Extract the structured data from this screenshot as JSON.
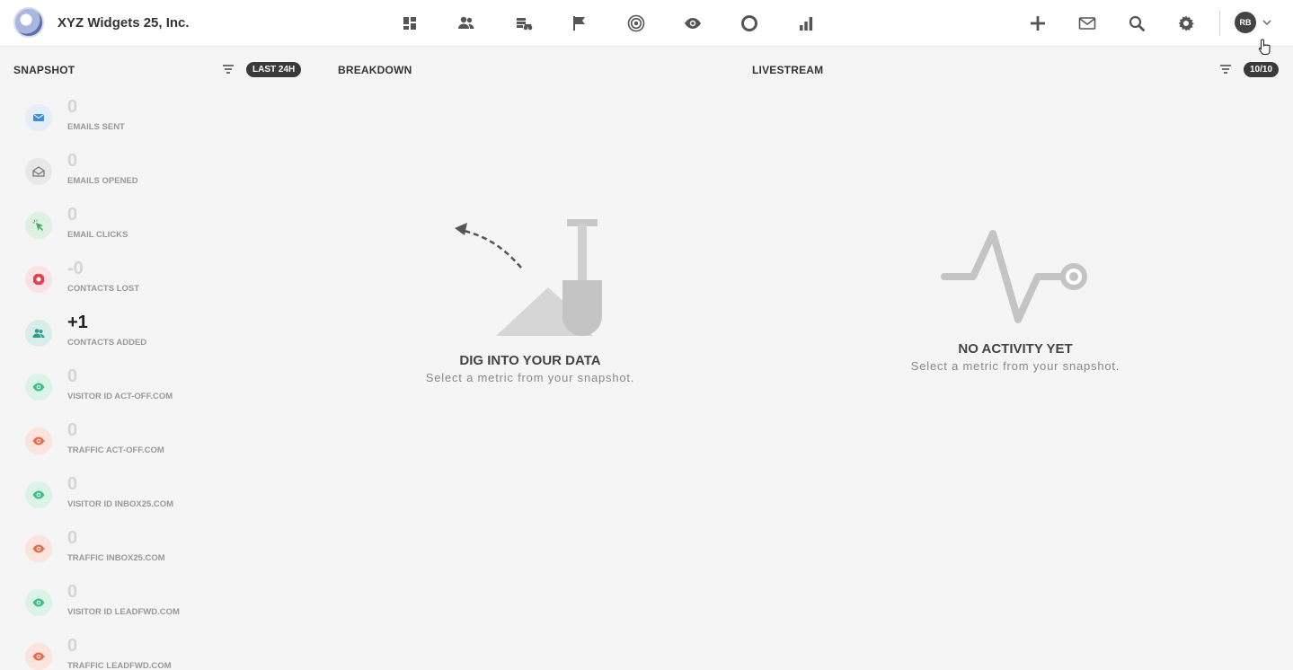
{
  "header": {
    "company": "XYZ Widgets 25, Inc.",
    "nav_icons": [
      "dashboard-icon",
      "contacts-icon",
      "companies-icon",
      "campaigns-flag-icon",
      "target-icon",
      "visitor-eye-icon",
      "circle-icon",
      "reports-bar-icon"
    ],
    "actions": [
      "plus-icon",
      "mail-icon",
      "search-icon",
      "gear-icon"
    ],
    "user_initials": "RB"
  },
  "snapshot": {
    "title": "SNAPSHOT",
    "range_pill": "LAST 24H",
    "metrics": [
      {
        "value": "0",
        "label": "EMAILS SENT",
        "icon": "email-sent-icon",
        "color": "#3d8fd9",
        "bg": "#e4eef8"
      },
      {
        "value": "0",
        "label": "EMAILS OPENED",
        "icon": "email-opened-icon",
        "color": "#777777",
        "bg": "#e8e8e8"
      },
      {
        "value": "0",
        "label": "EMAIL CLICKS",
        "icon": "click-cursor-icon",
        "color": "#3fae55",
        "bg": "#dff1e2"
      },
      {
        "value": "-0",
        "label": "CONTACTS LOST",
        "icon": "contacts-lost-icon",
        "color": "#e0424f",
        "bg": "#fbe2e4"
      },
      {
        "value": "+1",
        "label": "CONTACTS ADDED",
        "icon": "contacts-added-icon",
        "color": "#2f9b8a",
        "bg": "#d9eeeb"
      },
      {
        "value": "0",
        "label": "VISITOR ID ACT-OFF.COM",
        "icon": "visitor-eye-icon",
        "color": "#38c285",
        "bg": "#dcf3e8"
      },
      {
        "value": "0",
        "label": "TRAFFIC ACT-OFF.COM",
        "icon": "traffic-eye-icon",
        "color": "#ea6b4c",
        "bg": "#fbe4dd"
      },
      {
        "value": "0",
        "label": "VISITOR ID INBOX25.COM",
        "icon": "visitor-eye-icon",
        "color": "#38c285",
        "bg": "#dcf3e8"
      },
      {
        "value": "0",
        "label": "TRAFFIC INBOX25.COM",
        "icon": "traffic-eye-icon",
        "color": "#ea6b4c",
        "bg": "#fbe4dd"
      },
      {
        "value": "0",
        "label": "VISITOR ID LEADFWD.COM",
        "icon": "visitor-eye-icon",
        "color": "#38c285",
        "bg": "#dcf3e8"
      },
      {
        "value": "0",
        "label": "TRAFFIC LEADFWD.COM",
        "icon": "traffic-eye-icon",
        "color": "#ea6b4c",
        "bg": "#fbe4dd"
      }
    ]
  },
  "breakdown": {
    "title": "BREAKDOWN",
    "empty_title": "DIG INTO YOUR DATA",
    "empty_sub": "Select a metric from your snapshot."
  },
  "livestream": {
    "title": "LIVESTREAM",
    "count_pill": "10/10",
    "empty_title": "NO ACTIVITY YET",
    "empty_sub": "Select a metric from your snapshot."
  }
}
